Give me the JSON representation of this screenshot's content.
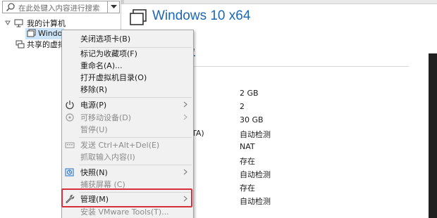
{
  "search": {
    "placeholder": "在此处键入内容进行搜索"
  },
  "tree": {
    "my_computer": "我的计算机",
    "vm_item": "Windo",
    "shared": "共享的虚拟"
  },
  "vm": {
    "title": "Windows 10 x64",
    "settings_link": "置"
  },
  "devices": [
    {
      "name": "",
      "value": "2 GB"
    },
    {
      "name": "",
      "value": "2"
    },
    {
      "name": "",
      "value": "30 GB"
    },
    {
      "name": "TA)",
      "value": "自动检测"
    },
    {
      "name": "",
      "value": "NAT"
    },
    {
      "name": "",
      "value": "存在"
    },
    {
      "name": "",
      "value": "自动检测"
    },
    {
      "name": "",
      "value": "存在"
    },
    {
      "name": "",
      "value": "自动检测"
    }
  ],
  "context_menu": {
    "close_tab": "关闭选项卡(B)",
    "favorite": "标记为收藏项(F)",
    "rename": "重命名(A)...",
    "open_dir": "打开虚拟机目录(O)",
    "remove": "移除(R)",
    "power": "电源(P)",
    "removable": "可移动设备(D)",
    "pause": "暂停(U)",
    "send_cad": "发送 Ctrl+Alt+Del(E)",
    "grab_input": "抓取输入内容(I)",
    "snapshot": "快照(N)",
    "capture": "捕获屏幕 (C)",
    "manage": "管理(M)",
    "install_tools": "安装 VMware Tools(T)..."
  },
  "colors": {
    "accent": "#1c67b5",
    "highlight_box": "#d6303a",
    "menu_bg": "#f1f1f1"
  }
}
